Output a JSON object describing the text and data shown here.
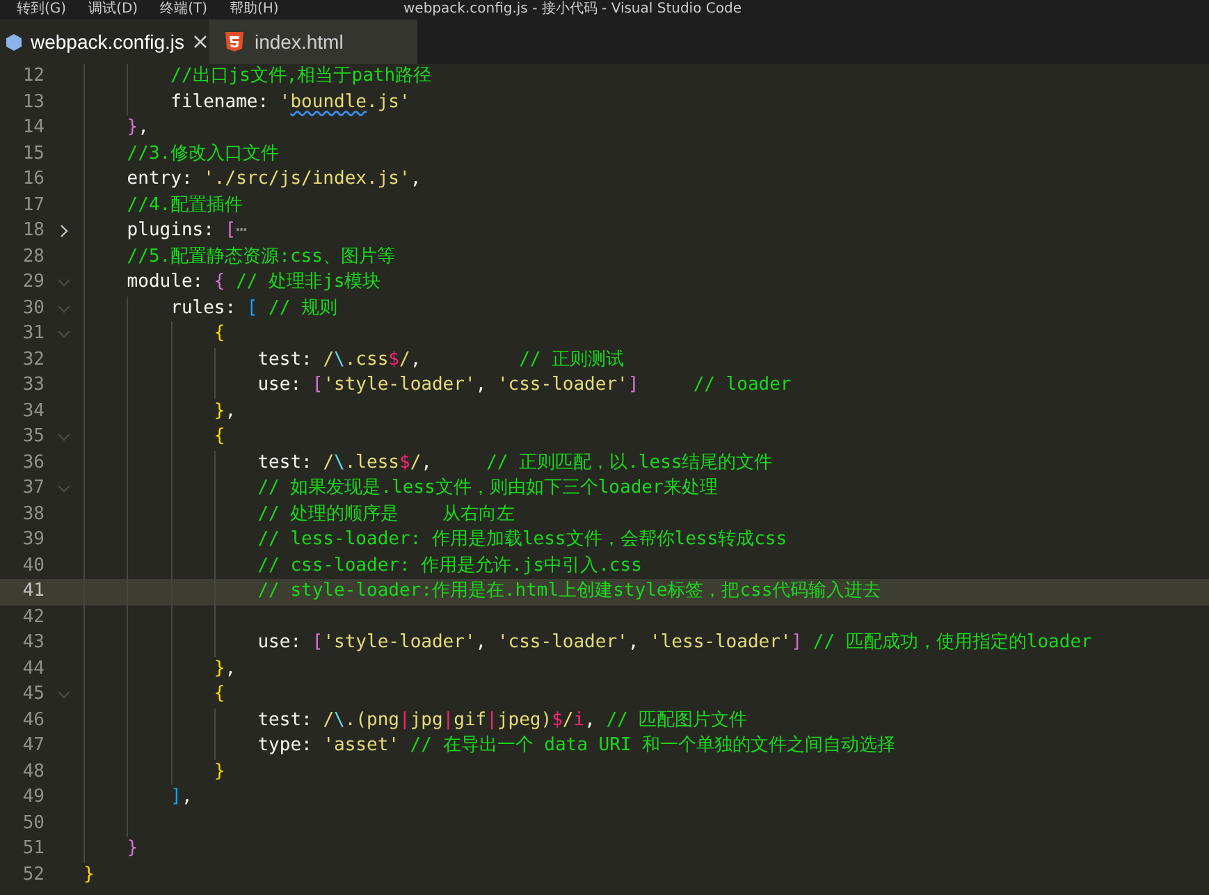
{
  "menu_bar": {
    "items": [
      "转到(G)",
      "调试(D)",
      "终端(T)",
      "帮助(H)"
    ],
    "title": "webpack.config.js - 接小代码 - Visual Studio Code"
  },
  "tabs": [
    {
      "label": "webpack.config.js",
      "kind": "js",
      "selected": true
    },
    {
      "label": "index.html",
      "kind": "html",
      "selected": false
    }
  ],
  "editor": {
    "lines": [
      {
        "number": "12",
        "tokens": [
          {
            "text": "        //出口js文件,相当于path路径",
            "kind": "comment"
          }
        ]
      },
      {
        "number": "13",
        "tokens": [
          {
            "text": "        filename: ",
            "kind": "plain"
          },
          {
            "text": "'",
            "kind": "string"
          },
          {
            "text": "boundle",
            "kind": "string",
            "squiggle": true
          },
          {
            "text": ".js'",
            "kind": "string"
          }
        ]
      },
      {
        "number": "14",
        "tokens": [
          {
            "text": "    }",
            "kind": "b1"
          },
          {
            "text": ",",
            "kind": "plain"
          }
        ]
      },
      {
        "number": "15",
        "tokens": [
          {
            "text": "    //3.修改入口文件",
            "kind": "comment"
          }
        ]
      },
      {
        "number": "16",
        "tokens": [
          {
            "text": "    entry: ",
            "kind": "plain"
          },
          {
            "text": "'./src/js/index.js'",
            "kind": "string"
          },
          {
            "text": ",",
            "kind": "plain"
          }
        ]
      },
      {
        "number": "17",
        "tokens": [
          {
            "text": "    //4.配置插件",
            "kind": "comment"
          }
        ]
      },
      {
        "number": "18",
        "folded": true,
        "tokens": [
          {
            "text": "    plugins: ",
            "kind": "plain"
          },
          {
            "text": "[",
            "kind": "b1"
          },
          {
            "text": "⋯",
            "kind": "folded"
          }
        ]
      },
      {
        "number": "28",
        "tokens": [
          {
            "text": "    //5.配置静态资源:css、图片等",
            "kind": "comment"
          }
        ]
      },
      {
        "number": "29",
        "folded": false,
        "tokens": [
          {
            "text": "    module: ",
            "kind": "plain"
          },
          {
            "text": "{",
            "kind": "b1"
          },
          {
            "text": " // 处理非js模块",
            "kind": "comment"
          }
        ]
      },
      {
        "number": "30",
        "folded": false,
        "tokens": [
          {
            "text": "        rules: ",
            "kind": "plain"
          },
          {
            "text": "[",
            "kind": "b2"
          },
          {
            "text": " // 规则",
            "kind": "comment"
          }
        ]
      },
      {
        "number": "31",
        "folded": false,
        "tokens": [
          {
            "text": "            {",
            "kind": "b3"
          }
        ]
      },
      {
        "number": "32",
        "tokens": [
          {
            "text": "                test: ",
            "kind": "plain"
          },
          {
            "text": "/",
            "kind": "string"
          },
          {
            "text": "\\",
            "kind": "escape"
          },
          {
            "text": ".css",
            "kind": "string"
          },
          {
            "text": "$",
            "kind": "op"
          },
          {
            "text": "/",
            "kind": "string"
          },
          {
            "text": ",         ",
            "kind": "plain"
          },
          {
            "text": "// 正则测试",
            "kind": "comment"
          }
        ]
      },
      {
        "number": "33",
        "tokens": [
          {
            "text": "                use: ",
            "kind": "plain"
          },
          {
            "text": "[",
            "kind": "b1"
          },
          {
            "text": "'style-loader'",
            "kind": "string"
          },
          {
            "text": ", ",
            "kind": "plain"
          },
          {
            "text": "'css-loader'",
            "kind": "string"
          },
          {
            "text": "]",
            "kind": "b1"
          },
          {
            "text": "     // loader",
            "kind": "comment"
          }
        ]
      },
      {
        "number": "34",
        "tokens": [
          {
            "text": "            }",
            "kind": "b3"
          },
          {
            "text": ",",
            "kind": "plain"
          }
        ]
      },
      {
        "number": "35",
        "folded": false,
        "tokens": [
          {
            "text": "            {",
            "kind": "b3"
          }
        ]
      },
      {
        "number": "36",
        "tokens": [
          {
            "text": "                test: ",
            "kind": "plain"
          },
          {
            "text": "/",
            "kind": "string"
          },
          {
            "text": "\\",
            "kind": "escape"
          },
          {
            "text": ".less",
            "kind": "string"
          },
          {
            "text": "$",
            "kind": "op"
          },
          {
            "text": "/",
            "kind": "string"
          },
          {
            "text": ",     ",
            "kind": "plain"
          },
          {
            "text": "// 正则匹配，以.less结尾的文件",
            "kind": "comment"
          }
        ]
      },
      {
        "number": "37",
        "folded": false,
        "tokens": [
          {
            "text": "                // 如果发现是.less文件，则由如下三个loader来处理",
            "kind": "comment"
          }
        ]
      },
      {
        "number": "38",
        "tokens": [
          {
            "text": "                // 处理的顺序是    从右向左",
            "kind": "comment"
          }
        ]
      },
      {
        "number": "39",
        "tokens": [
          {
            "text": "                // less-loader: 作用是加载less文件，会帮你less转成css",
            "kind": "comment"
          }
        ]
      },
      {
        "number": "40",
        "tokens": [
          {
            "text": "                // css-loader: 作用是允许.js中引入.css",
            "kind": "comment"
          }
        ]
      },
      {
        "number": "41",
        "current": true,
        "tokens": [
          {
            "text": "                // style-loader:作用是在.html上创建style标签，把css代码输入进去",
            "kind": "comment"
          }
        ]
      },
      {
        "number": "42"
      },
      {
        "number": "43",
        "tokens": [
          {
            "text": "                use: ",
            "kind": "plain"
          },
          {
            "text": "[",
            "kind": "b1"
          },
          {
            "text": "'style-loader'",
            "kind": "string"
          },
          {
            "text": ", ",
            "kind": "plain"
          },
          {
            "text": "'css-loader'",
            "kind": "string"
          },
          {
            "text": ", ",
            "kind": "plain"
          },
          {
            "text": "'less-loader'",
            "kind": "string"
          },
          {
            "text": "]",
            "kind": "b1"
          },
          {
            "text": " // 匹配成功，使用指定的loader",
            "kind": "comment"
          }
        ]
      },
      {
        "number": "44",
        "tokens": [
          {
            "text": "            }",
            "kind": "b3"
          },
          {
            "text": ",",
            "kind": "plain"
          }
        ]
      },
      {
        "number": "45",
        "folded": false,
        "tokens": [
          {
            "text": "            {",
            "kind": "b3"
          }
        ]
      },
      {
        "number": "46",
        "tokens": [
          {
            "text": "                test: ",
            "kind": "plain"
          },
          {
            "text": "/",
            "kind": "string"
          },
          {
            "text": "\\",
            "kind": "escape"
          },
          {
            "text": ".(png",
            "kind": "string"
          },
          {
            "text": "|",
            "kind": "op"
          },
          {
            "text": "jpg",
            "kind": "string"
          },
          {
            "text": "|",
            "kind": "op"
          },
          {
            "text": "gif",
            "kind": "string"
          },
          {
            "text": "|",
            "kind": "op"
          },
          {
            "text": "jpeg)",
            "kind": "string"
          },
          {
            "text": "$",
            "kind": "op"
          },
          {
            "text": "/",
            "kind": "string"
          },
          {
            "text": "i",
            "kind": "op"
          },
          {
            "text": ", ",
            "kind": "plain"
          },
          {
            "text": "// 匹配图片文件",
            "kind": "comment"
          }
        ]
      },
      {
        "number": "47",
        "tokens": [
          {
            "text": "                type: ",
            "kind": "plain"
          },
          {
            "text": "'asset'",
            "kind": "string"
          },
          {
            "text": " // 在导出一个 data URI 和一个单独的文件之间自动选择",
            "kind": "comment"
          }
        ]
      },
      {
        "number": "48",
        "tokens": [
          {
            "text": "            }",
            "kind": "b3"
          }
        ]
      },
      {
        "number": "49",
        "tokens": [
          {
            "text": "        ]",
            "kind": "b2"
          },
          {
            "text": ",",
            "kind": "plain"
          }
        ]
      },
      {
        "number": "50"
      },
      {
        "number": "51",
        "tokens": [
          {
            "text": "    }",
            "kind": "b1"
          }
        ]
      },
      {
        "number": "52",
        "tokens": [
          {
            "text": "}",
            "kind": "b3"
          }
        ]
      }
    ]
  }
}
